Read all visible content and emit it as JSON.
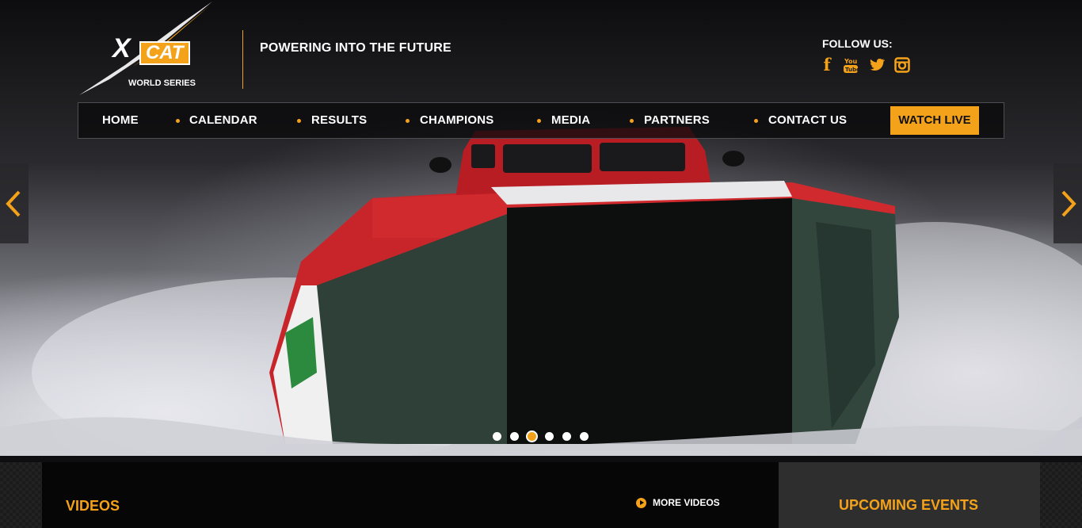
{
  "header": {
    "logo_text": "CAT",
    "logo_x": "X",
    "logo_sub": "WORLD SERIES",
    "tagline": "POWERING INTO THE FUTURE",
    "follow_label": "FOLLOW US:",
    "social": [
      "facebook-icon",
      "youtube-icon",
      "twitter-icon",
      "instagram-icon"
    ]
  },
  "nav": {
    "items": [
      "HOME",
      "CALENDAR",
      "RESULTS",
      "CHAMPIONS",
      "MEDIA",
      "PARTNERS",
      "CONTACT US"
    ],
    "watch_live": "WATCH LIVE"
  },
  "slider": {
    "slide_count": 6,
    "active_slide": 3
  },
  "videos": {
    "title": "VIDEOS",
    "more_label": "MORE VIDEOS"
  },
  "events": {
    "title": "UPCOMING EVENTS"
  },
  "colors": {
    "accent": "#f5a21b",
    "nav_bg": "#0a0a0c",
    "panel_dark": "#060606",
    "panel_grey": "#2e2e2e"
  }
}
